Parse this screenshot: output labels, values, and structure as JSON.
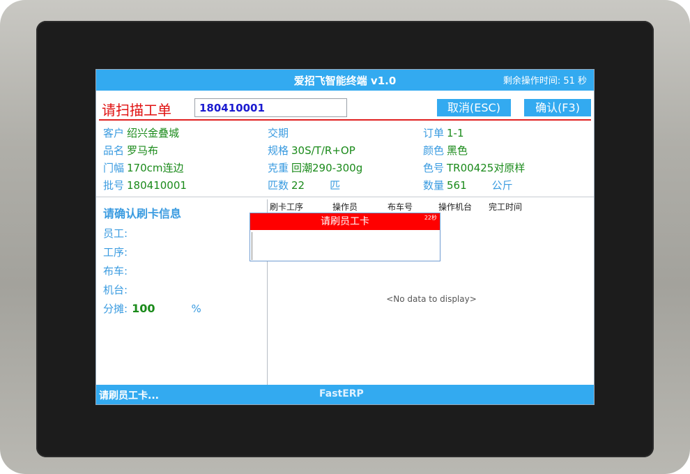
{
  "titlebar": {
    "title": "爱招飞智能终端 v1.0",
    "timer": "剩余操作时间: 51 秒"
  },
  "scan": {
    "label": "请扫描工单",
    "value": "180410001",
    "cancel_label": "取消(ESC)",
    "confirm_label": "确认(F3)"
  },
  "info": {
    "customer_label": "客户",
    "customer_value": "绍兴金叠城",
    "product_label": "品名",
    "product_value": "罗马布",
    "width_label": "门幅",
    "width_value": "170cm连边",
    "batch_label": "批号",
    "batch_value": "180410001",
    "delivery_label": "交期",
    "delivery_value": "",
    "spec_label": "规格",
    "spec_value": "30S/T/R+OP",
    "weight_label": "克重",
    "weight_value": "回潮290-300g",
    "pieces_label": "匹数",
    "pieces_value": "22",
    "pieces_unit": "匹",
    "order_label": "订单",
    "order_value": "1-1",
    "color_label": "颜色",
    "color_value": "黑色",
    "colorno_label": "色号",
    "colorno_value": "TR00425对原样",
    "qty_label": "数量",
    "qty_value": "561",
    "qty_unit": "公斤"
  },
  "card": {
    "title": "请确认刷卡信息",
    "employee": "员工:",
    "process": "工序:",
    "cart": "布车:",
    "machine": "机台:",
    "share_label": "分摊:",
    "share_value": "100",
    "share_unit": "%"
  },
  "grid": {
    "columns": [
      "刷卡工序",
      "操作员",
      "布车号",
      "操作机台",
      "完工时间"
    ],
    "empty_text": "<No data to display>"
  },
  "popup": {
    "title": "请刷员工卡",
    "countdown": "22秒"
  },
  "status": {
    "left": "请刷员工卡...",
    "brand": "FastERP"
  },
  "colors": {
    "accent": "#33aaf0",
    "alert": "#ff0000",
    "value_green": "#1a8a1a",
    "label_blue": "#3a9be0"
  }
}
